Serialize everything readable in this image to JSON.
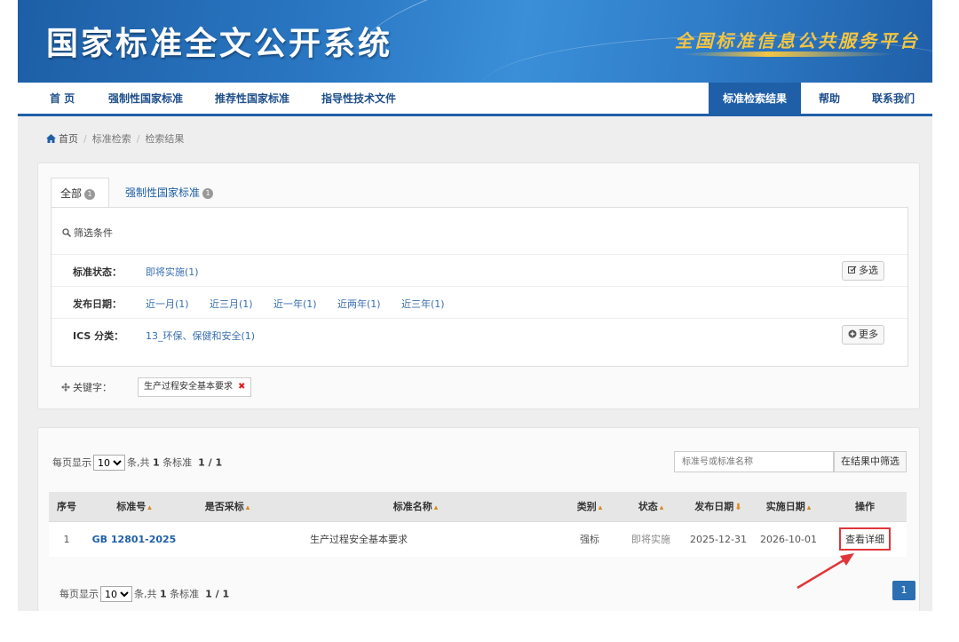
{
  "banner": {
    "title": "国家标准全文公开系统",
    "slogan": "全国标准信息公共服务平台"
  },
  "nav": {
    "items": [
      {
        "label": "首 页"
      },
      {
        "label": "强制性国家标准"
      },
      {
        "label": "推荐性国家标准"
      },
      {
        "label": "指导性技术文件"
      },
      {
        "label": "标准检索结果"
      },
      {
        "label": "帮助"
      },
      {
        "label": "联系我们"
      }
    ]
  },
  "breadcrumb": {
    "home": "首页",
    "level2": "标准检索",
    "current": "检索结果"
  },
  "tabs": {
    "all": {
      "label": "全部",
      "count": "1"
    },
    "mandatory": {
      "label": "强制性国家标准",
      "count": "1"
    }
  },
  "filters": {
    "heading": "筛选条件",
    "status": {
      "label": "标准状态：",
      "options": [
        "即将实施(1)"
      ],
      "button": "多选"
    },
    "date": {
      "label": "发布日期：",
      "options": [
        "近一月(1)",
        "近三月(1)",
        "近一年(1)",
        "近两年(1)",
        "近三年(1)"
      ]
    },
    "ics": {
      "label": "ICS 分类：",
      "options": [
        "13_环保、保健和安全(1)"
      ],
      "button": "更多"
    },
    "keyword": {
      "label": "关键字：",
      "value": "生产过程安全基本要求"
    }
  },
  "results": {
    "pager_top": {
      "prefix": "每页显示",
      "per_page": "10",
      "suffix_a": "条,共",
      "total": "1",
      "suffix_b": "条标准",
      "pages": "1 / 1"
    },
    "pager_bottom": {
      "prefix": "每页显示",
      "per_page": "10",
      "suffix_a": "条,共",
      "total": "1",
      "suffix_b": "条标准",
      "pages": "1 / 1"
    },
    "search_placeholder": "标准号或标准名称",
    "search_button": "在结果中筛选",
    "columns": [
      "序号",
      "标准号",
      "是否采标",
      "标准名称",
      "类别",
      "状态",
      "发布日期",
      "实施日期",
      "操作"
    ],
    "rows": [
      {
        "index": "1",
        "std_no": "GB 12801-2025",
        "adopted": "",
        "name": "生产过程安全基本要求",
        "category": "强标",
        "status": "即将实施",
        "publish": "2025-12-31",
        "implement": "2026-10-01",
        "action": "查看详细"
      }
    ],
    "current_page": "1"
  },
  "colors": {
    "brand_blue": "#1f5fa8",
    "highlight_red": "#e0363a",
    "slogan_gold": "#f4c542"
  }
}
